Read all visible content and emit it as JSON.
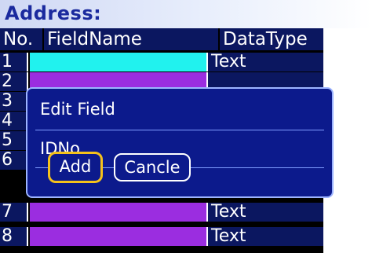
{
  "title": "Address:",
  "columns": [
    "No.",
    "FieldName",
    "DataType"
  ],
  "rows": [
    {
      "no": "1",
      "type": "Text"
    },
    {
      "no": "2",
      "type": ""
    },
    {
      "no": "3",
      "type": ""
    },
    {
      "no": "4",
      "type": ""
    },
    {
      "no": "5",
      "type": ""
    },
    {
      "no": "6",
      "type": ""
    },
    {
      "no": "7",
      "type": "Text"
    },
    {
      "no": "8",
      "type": "Text"
    }
  ],
  "dialog": {
    "title": "Edit Field",
    "value": "IDNo",
    "add_label": "Add",
    "cancel_label": "Cancle"
  },
  "colors": {
    "header_bg": "#0b1760",
    "field_cell": "#9b2de0",
    "active_field_cell": "#21f2ee",
    "dialog_bg": "#0c1a8c",
    "focus_ring": "#f5c21b"
  }
}
